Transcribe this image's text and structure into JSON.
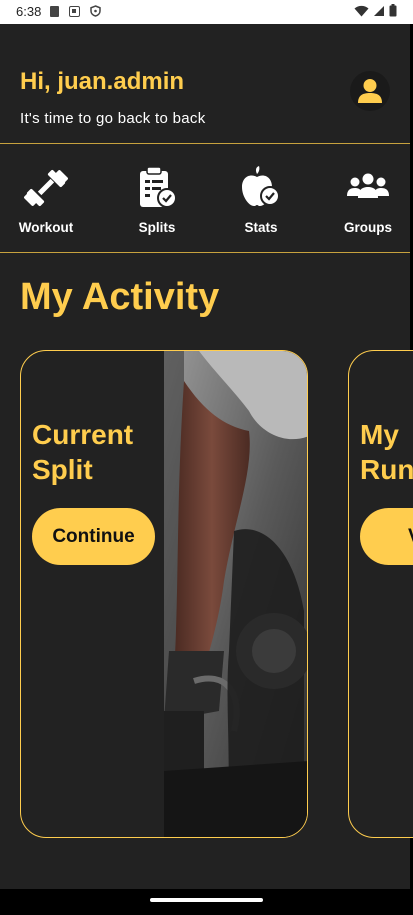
{
  "status_bar": {
    "time": "6:38"
  },
  "header": {
    "greeting": "Hi, juan.admin",
    "subtitle": "It's time to go back to back",
    "avatar_icon": "person-icon"
  },
  "nav": [
    {
      "label": "Workout",
      "icon": "dumbbell-icon"
    },
    {
      "label": "Splits",
      "icon": "clipboard-check-icon"
    },
    {
      "label": "Stats",
      "icon": "apple-check-icon"
    },
    {
      "label": "Groups",
      "icon": "group-icon"
    }
  ],
  "section_title": "My Activity",
  "cards": [
    {
      "title_line1": "Current",
      "title_line2": "Split",
      "button": "Continue"
    },
    {
      "title_line1": "My",
      "title_line2": "Run",
      "button": "V"
    }
  ],
  "colors": {
    "accent": "#FFCD4E",
    "background": "#222222",
    "divider": "#C7A23E"
  }
}
